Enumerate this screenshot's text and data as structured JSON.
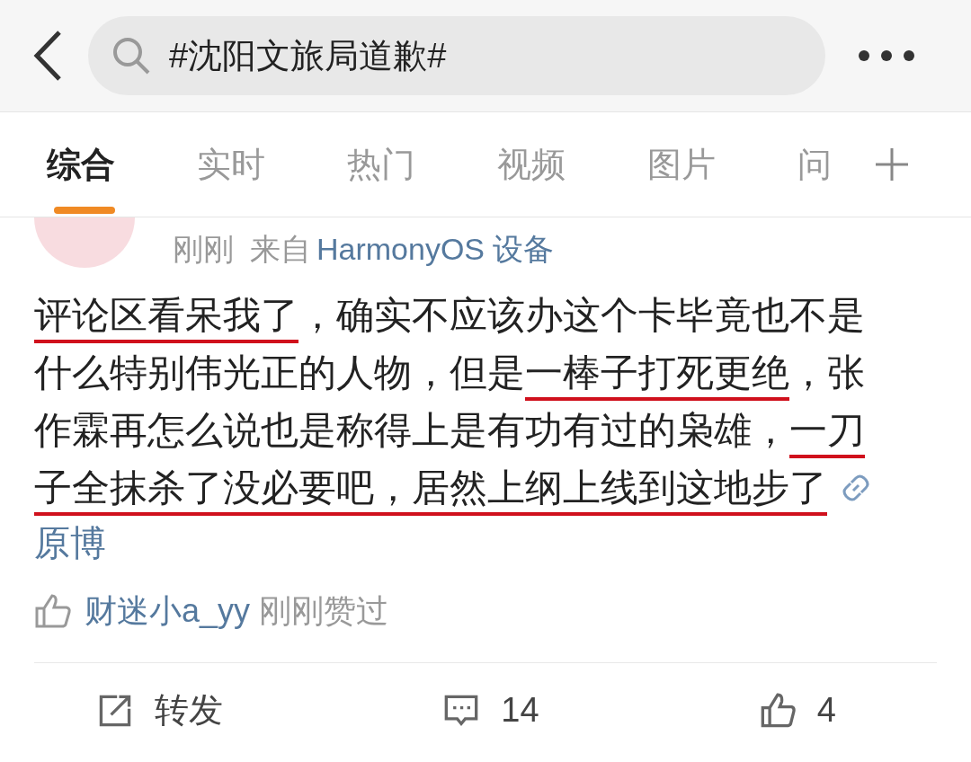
{
  "search": {
    "query": "#沈阳文旅局道歉#"
  },
  "tabs": [
    {
      "label": "综合",
      "selected": true
    },
    {
      "label": "实时",
      "selected": false
    },
    {
      "label": "热门",
      "selected": false
    },
    {
      "label": "视频",
      "selected": false
    },
    {
      "label": "图片",
      "selected": false
    },
    {
      "label": "问",
      "selected": false
    }
  ],
  "post": {
    "time": "刚刚",
    "source_prefix": "来自",
    "source": "HarmonyOS 设备",
    "body": [
      {
        "text": "评论区看呆我了",
        "underlined": true
      },
      {
        "text": "，确实不应该办这个卡毕竟也不是什么特别伟光正的人物，但是",
        "underlined": false
      },
      {
        "text": "一棒子打死更绝",
        "underlined": true
      },
      {
        "text": "，张作霖再怎么说也是称得上是有功有过的枭雄，",
        "underlined": false
      },
      {
        "text": "一刀子全抹杀了没必要吧，居然上纲上线到这地步了",
        "underlined": true
      }
    ],
    "link": "原博",
    "liked_by": {
      "user": "财迷小a_yy",
      "text": "刚刚赞过"
    },
    "actions": [
      {
        "kind": "repost",
        "label": "转发"
      },
      {
        "kind": "comment",
        "label": "14"
      },
      {
        "kind": "like",
        "label": "4"
      }
    ]
  }
}
